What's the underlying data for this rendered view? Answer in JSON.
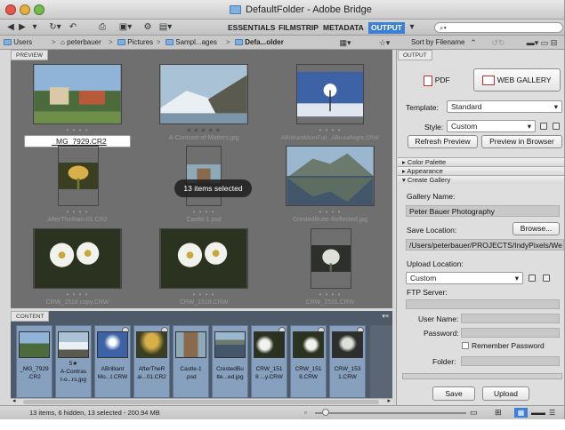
{
  "window": {
    "title": "DefaultFolder - Adobe Bridge"
  },
  "toolbar": {
    "workspaces": [
      "ESSENTIALS",
      "FILMSTRIP",
      "METADATA",
      "OUTPUT"
    ],
    "search_placeholder": "⌕▾"
  },
  "breadcrumb": [
    "Users",
    "peterbauer",
    "Pictures",
    "Sampl...ages",
    "Defa...older"
  ],
  "sort_label": "Sort by Filename",
  "preview": {
    "tab": "PREVIEW",
    "hud": "13 items selected",
    "thumbs": [
      {
        "name": "_MG_7929.CR2",
        "rating": "• • • •",
        "selected": true
      },
      {
        "name": "A-Contrast-of-Matters.jpg",
        "rating": "★★★★★"
      },
      {
        "name": "ABrilliantMornFull...ABrutalNight.CRW",
        "rating": "• • • •"
      },
      {
        "name": "AfterTheRain-01.CR2",
        "rating": "• • • •"
      },
      {
        "name": "Castle-1.psd",
        "rating": "• • • •"
      },
      {
        "name": "CrestedButte-Reflected.jpg",
        "rating": "• • • •"
      },
      {
        "name": "CRW_1518 copy.CRW",
        "rating": "• • • •"
      },
      {
        "name": "CRW_1518.CRW",
        "rating": "• • • •"
      },
      {
        "name": "CRW_1531.CRW",
        "rating": "• • • •"
      }
    ]
  },
  "content": {
    "tab": "CONTENT",
    "items": [
      {
        "label": "_MG_7929\n.CR2"
      },
      {
        "label": "5★\nA-Contras\nt-o...rs.jpg"
      },
      {
        "label": "ABrilliant\nMo...t.CRW"
      },
      {
        "label": "AfterTheR\nai...01.CR2"
      },
      {
        "label": "Castle-1\n.psd"
      },
      {
        "label": "CrestedBu\ntte...ed.jpg"
      },
      {
        "label": "CRW_151\n8 ...y.CRW"
      },
      {
        "label": "CRW_151\n8.CRW"
      },
      {
        "label": "CRW_153\n1.CRW"
      }
    ]
  },
  "status": {
    "text": "13 items, 6 hidden, 13 selected - 200.94 MB"
  },
  "output": {
    "tab": "OUTPUT",
    "pdf": "PDF",
    "web_gallery": "WEB GALLERY",
    "template_label": "Template:",
    "template_value": "Standard",
    "style_label": "Style:",
    "style_value": "Custom",
    "refresh": "Refresh Preview",
    "preview_browser": "Preview in Browser",
    "sections": [
      "▸ Color Palette",
      "▸ Appearance",
      "▾ Create Gallery"
    ],
    "gallery_name_label": "Gallery Name:",
    "gallery_name": "Peter Bauer Photography",
    "save_location_label": "Save Location:",
    "browse": "Browse...",
    "save_path": "/Users/peterbauer/PROJECTS/IndyPixels/We",
    "upload_location_label": "Upload Location:",
    "upload_value": "Custom",
    "ftp_label": "FTP Server:",
    "user_label": "User Name:",
    "password_label": "Password:",
    "remember": "Remember Password",
    "folder_label": "Folder:",
    "save": "Save",
    "upload": "Upload"
  }
}
